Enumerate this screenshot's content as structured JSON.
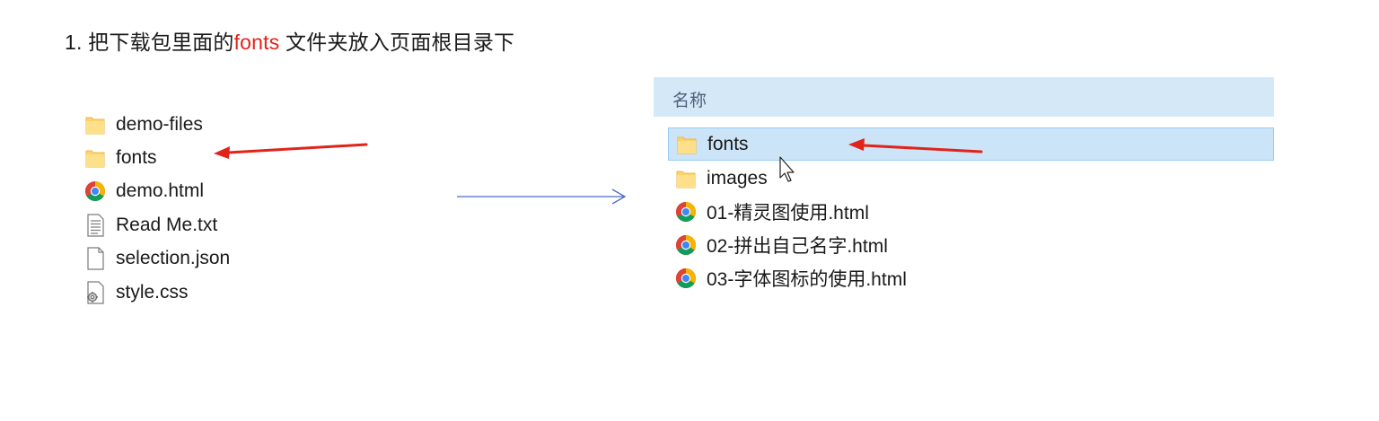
{
  "heading": {
    "prefix": "1. 把下载包里面的",
    "highlight": "fonts",
    "suffix": "文件夹放入页面根目录下"
  },
  "left_list": {
    "items": [
      {
        "label": "demo-files",
        "icon": "folder-icon"
      },
      {
        "label": "fonts",
        "icon": "folder-icon"
      },
      {
        "label": "demo.html",
        "icon": "chrome-icon"
      },
      {
        "label": "Read Me.txt",
        "icon": "text-file-icon"
      },
      {
        "label": "selection.json",
        "icon": "blank-file-icon"
      },
      {
        "label": "style.css",
        "icon": "css-file-icon"
      }
    ]
  },
  "explorer": {
    "column_header": "名称",
    "items": [
      {
        "label": "fonts",
        "icon": "folder-icon",
        "selected": true
      },
      {
        "label": "images",
        "icon": "folder-icon",
        "selected": false
      },
      {
        "label": "01-精灵图使用.html",
        "icon": "chrome-icon",
        "selected": false
      },
      {
        "label": "02-拼出自己名字.html",
        "icon": "chrome-icon",
        "selected": false
      },
      {
        "label": "03-字体图标的使用.html",
        "icon": "chrome-icon",
        "selected": false
      }
    ]
  },
  "colors": {
    "highlight_text": "#e2231a",
    "annotation_arrow": "#e2231a",
    "flow_arrow": "#4a6cc4",
    "header_bg": "#d5e8f8",
    "selection_bg": "#cce4f7",
    "selection_border": "#99cdf3"
  }
}
